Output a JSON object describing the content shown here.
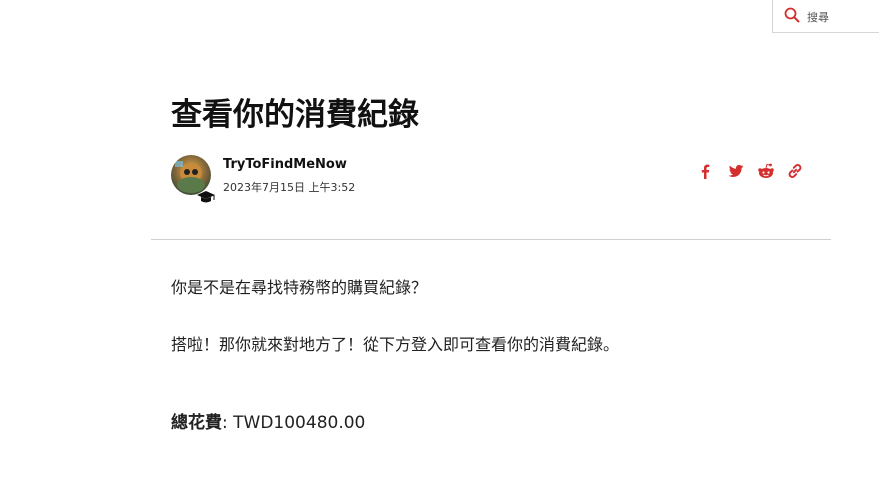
{
  "search": {
    "placeholder": "搜尋"
  },
  "article": {
    "title": "查看你的消費紀錄",
    "author": {
      "name": "TryToFindMeNow",
      "date": "2023年7月15日 上午3:52"
    },
    "share": {
      "icons": [
        "facebook-icon",
        "twitter-icon",
        "reddit-icon",
        "link-icon"
      ],
      "color": "#d32f2f"
    },
    "body": {
      "paragraph_1": "你是不是在尋找特務幣的購買紀錄？",
      "paragraph_2": "搭啦！那你就來對地方了！從下方登入即可查看你的消費紀錄。",
      "total_label": "總花費",
      "total_separator": ": ",
      "total_value": "TWD100480.00"
    }
  }
}
